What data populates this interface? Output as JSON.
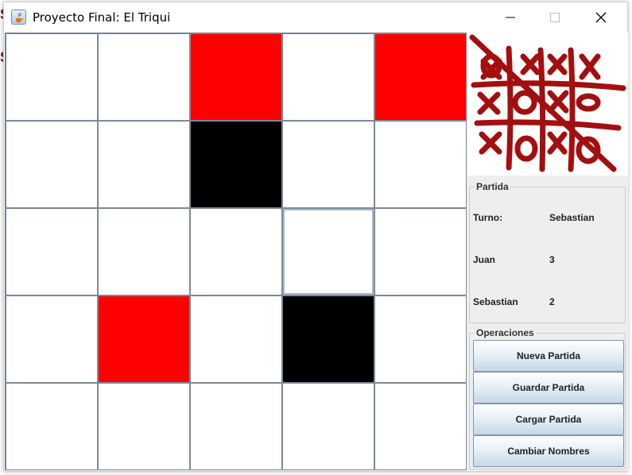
{
  "background_fragments": [
    "S",
    "S"
  ],
  "window": {
    "title": "Proyecto Final: El Triqui",
    "controls": [
      "minimize-icon",
      "maximize-icon",
      "close-icon"
    ]
  },
  "board": {
    "rows": 5,
    "cols": 5,
    "cells": [
      [
        "empty",
        "empty",
        "red",
        "empty",
        "red"
      ],
      [
        "empty",
        "empty",
        "black",
        "empty",
        "empty"
      ],
      [
        "empty",
        "empty",
        "empty",
        "focused",
        "empty"
      ],
      [
        "empty",
        "red",
        "empty",
        "black",
        "empty"
      ],
      [
        "empty",
        "empty",
        "empty",
        "empty",
        "empty"
      ]
    ],
    "colors": {
      "red": "#ff0000",
      "black": "#000000",
      "empty": "#ffffff"
    }
  },
  "logo": {
    "icon": "tic-tac-toe-logo",
    "color": "#a30f0f"
  },
  "partida": {
    "title": "Partida",
    "turn_label": "Turno:",
    "turn_value": "Sebastian",
    "player1_name": "Juan",
    "player1_score": "3",
    "player2_name": "Sebastian",
    "player2_score": "2"
  },
  "operaciones": {
    "title": "Operaciones",
    "buttons": [
      "Nueva Partida",
      "Guardar Partida",
      "Cargar Partida",
      "Cambiar Nombres"
    ]
  }
}
